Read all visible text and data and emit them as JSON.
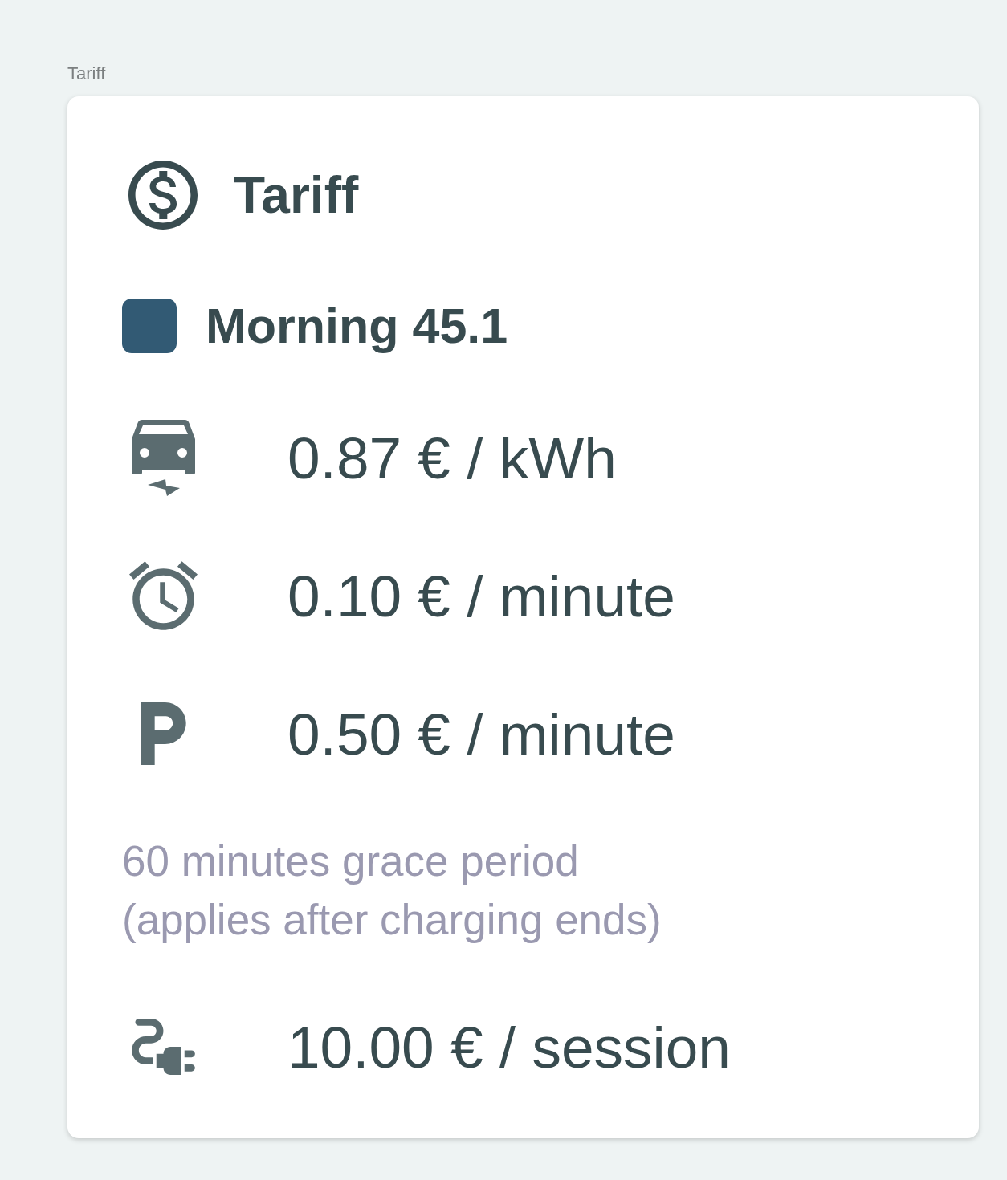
{
  "page_label": "Tariff",
  "card": {
    "title": "Tariff",
    "tariff_name": "Morning 45.1",
    "rows": [
      {
        "kind": "energy",
        "text": "0.87 € / kWh"
      },
      {
        "kind": "time",
        "text": "0.10 € / minute"
      },
      {
        "kind": "parking",
        "text": "0.50 € / minute"
      },
      {
        "kind": "note",
        "lines": [
          "60 minutes grace period",
          "(applies after charging ends)"
        ]
      },
      {
        "kind": "session",
        "text": "10.00 € / session"
      }
    ]
  }
}
